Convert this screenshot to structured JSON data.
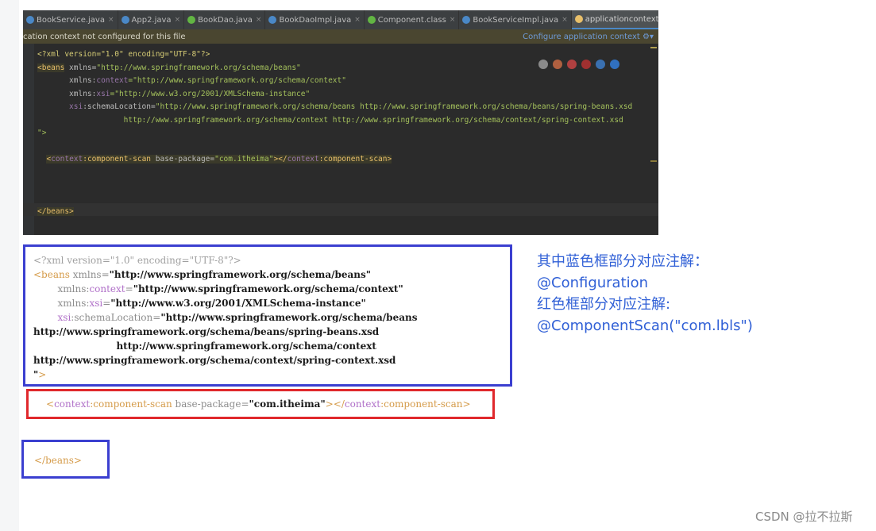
{
  "ide": {
    "tabs": [
      {
        "label": "BookService.java",
        "color": "#4a88c7",
        "active": false
      },
      {
        "label": "App2.java",
        "color": "#4a88c7",
        "active": false
      },
      {
        "label": "BookDao.java",
        "color": "#62b543",
        "active": false
      },
      {
        "label": "BookDaoImpl.java",
        "color": "#4a88c7",
        "active": false
      },
      {
        "label": "Component.class",
        "color": "#62b543",
        "active": false
      },
      {
        "label": "BookServiceImpl.java",
        "color": "#4a88c7",
        "active": false
      },
      {
        "label": "applicationcontext.xml",
        "color": "#e8bf6a",
        "active": true
      }
    ],
    "tab_more": "»≡",
    "notification": "cation context not configured for this file",
    "configure_link": "Configure application context",
    "code": {
      "line1_decl": "<?xml version=\"1.0\" encoding=\"UTF-8\"?>",
      "beans_open": "<beans",
      "xmlns_attr": " xmlns=",
      "xmlns_val": "\"http://www.springframework.org/schema/beans\"",
      "ctx_prefix": "       xmlns:",
      "ctx_name": "context",
      "ctx_val": "=\"http://www.springframework.org/schema/context\"",
      "xsi_prefix": "       xmlns:",
      "xsi_name": "xsi",
      "xsi_val": "=\"http://www.w3.org/2001/XMLSchema-instance\"",
      "schema_ns": "       xsi",
      "schema_attr": ":schemaLocation=",
      "schema_val1": "\"http://www.springframework.org/schema/beans http://www.springframework.org/schema/beans/spring-beans.xsd",
      "schema_val2": "                   http://www.springframework.org/schema/context http://www.springframework.org/schema/context/spring-context.xsd",
      "close_quote": "\">",
      "scan_open": "<",
      "scan_ns": "context",
      "scan_tag": ":component-scan",
      "scan_attr": " base-package=",
      "scan_val": "\"com.itheima\"",
      "scan_close_open": "></",
      "scan_close_ns": "context",
      "scan_close_tag": ":component-scan>",
      "beans_close": "</beans>"
    }
  },
  "xml_snippet": {
    "decl": "<?xml version=\"1.0\" encoding=\"UTF-8\"?>",
    "beans_open": "<beans",
    "xmlns_attr": " xmlns=",
    "xmlns_val": "\"http://www.springframework.org/schema/beans\"",
    "ctx_indent": "        xmlns:",
    "ctx_name": "context",
    "ctx_eq": "=",
    "ctx_val": "\"http://www.springframework.org/schema/context\"",
    "xsi_indent": "        xmlns:",
    "xsi_name": "xsi",
    "xsi_eq": "=",
    "xsi_val": "\"http://www.w3.org/2001/XMLSchema-instance\"",
    "schema_ns": "        xsi",
    "schema_attr": ":schemaLocation=",
    "schema_val1": "\"http://www.springframework.org/schema/beans",
    "schema_val2": "http://www.springframework.org/schema/beans/spring-beans.xsd",
    "schema_val3": "                         http://www.springframework.org/schema/context",
    "schema_val4": "http://www.springframework.org/schema/context/spring-context.xsd",
    "close_quote": "\"",
    "close_gt": ">",
    "scan_lt": "<",
    "scan_ns": "context",
    "scan_tag": ":component-scan",
    "scan_attr": " base-package=",
    "scan_val": "\"com.itheima\"",
    "scan_mid": "></",
    "scan_ns2": "context",
    "scan_tag2": ":component-scan>",
    "beans_close": "</beans>"
  },
  "note": {
    "line1": "其中蓝色框部分对应注解：",
    "line2": "@Configuration",
    "line3": "红色框部分对应注解:",
    "line4": "@ComponentScan(\"com.lbls\")"
  },
  "watermark": "CSDN @拉不拉斯"
}
